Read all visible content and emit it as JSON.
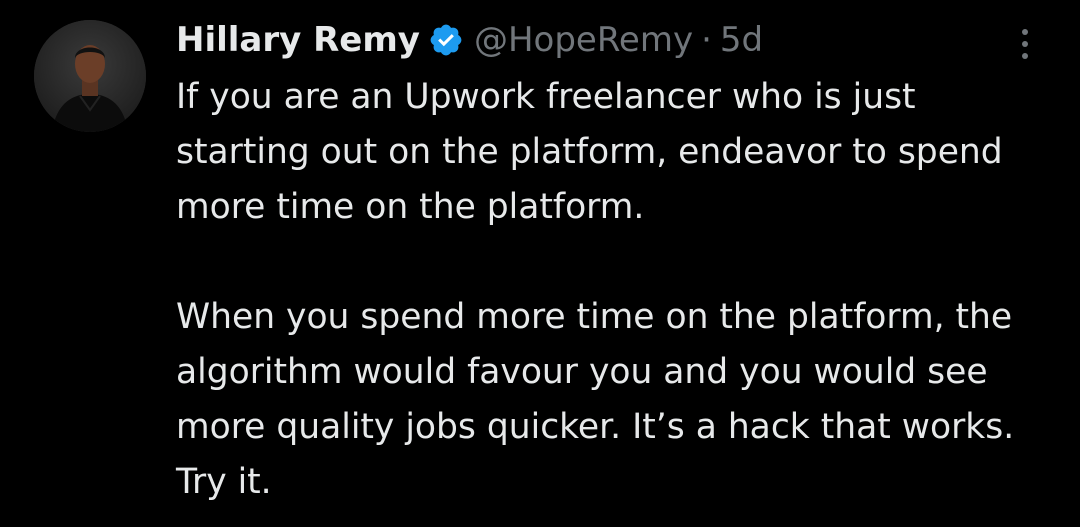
{
  "tweet": {
    "author": {
      "display_name": "Hillary Remy",
      "handle": "@HopeRemy",
      "verified": true
    },
    "separator": "·",
    "timestamp": "5d",
    "paragraphs": [
      "If you are an Upwork freelancer who is just starting out on the platform, endeavor to spend more time on the platform.",
      "When you spend more time on the platform, the algorithm would favour you and you would see more quality jobs quicker. It’s a hack that works. Try it."
    ]
  },
  "icons": {
    "verified": "verified-badge-icon",
    "more": "more-options-icon"
  },
  "colors": {
    "background": "#000000",
    "text_primary": "#e7e9ea",
    "text_secondary": "#71767b",
    "verified_blue": "#1d9bf0"
  }
}
